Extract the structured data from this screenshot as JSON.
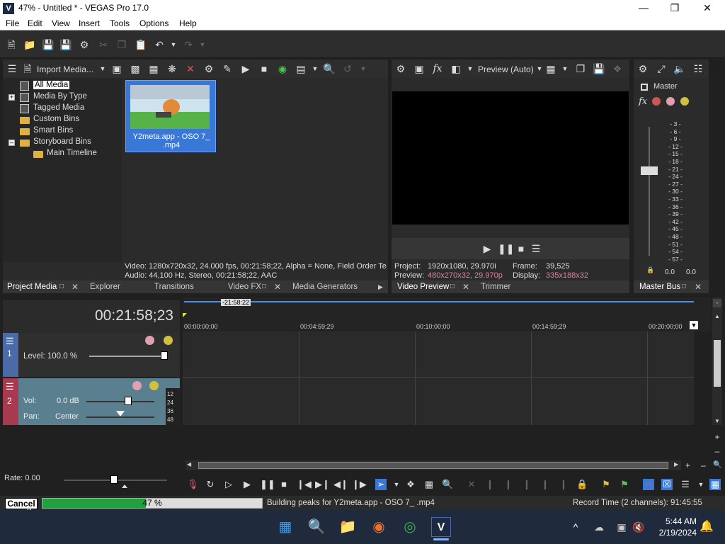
{
  "window": {
    "title": "47% - Untitled * - VEGAS Pro 17.0",
    "logo": "V"
  },
  "menu": [
    "File",
    "Edit",
    "View",
    "Insert",
    "Tools",
    "Options",
    "Help"
  ],
  "project_media": {
    "import_label": "Import Media...",
    "tree": [
      "All Media",
      "Media By Type",
      "Tagged Media",
      "Custom Bins",
      "Smart Bins",
      "Storyboard Bins",
      "Main Timeline"
    ],
    "clip_name": "Y2meta.app - OSO 7_ .mp4",
    "info_video": "Video: 1280x720x32, 24.000 fps, 00:21:58;22, Alpha = None, Field Order Te",
    "info_audio": "Audio: 44,100 Hz, Stereo, 00:21:58;22, AAC"
  },
  "tabs_left": [
    "Project Media",
    "Explorer",
    "Transitions",
    "Video FX",
    "Media Generators"
  ],
  "preview": {
    "mode": "Preview (Auto)",
    "project_label": "Project:",
    "project_val": "1920x1080, 29.970i",
    "preview_label": "Preview:",
    "preview_val": "480x270x32, 29.970p",
    "frame_label": "Frame:",
    "frame_val": "39,525",
    "display_label": "Display:",
    "display_val": "335x188x32"
  },
  "tabs_mid": [
    "Video Preview",
    "Trimmer"
  ],
  "master": {
    "label": "Master",
    "tab": "Master Bus",
    "left": "0.0",
    "right": "0.0",
    "scale": [
      "3",
      "6",
      "9",
      "12",
      "15",
      "18",
      "21",
      "24",
      "27",
      "30",
      "33",
      "36",
      "39",
      "42",
      "45",
      "48",
      "51",
      "54",
      "57"
    ]
  },
  "timeline": {
    "timecode": "00:21:58;23",
    "marker": "-21:58:22",
    "ruler": [
      "00:00:00;00",
      "00:04:59;29",
      "00:10:00;00",
      "00:14:59;29",
      "00:20:00;00"
    ],
    "track1": {
      "num": "1",
      "level": "Level: 100.0 %"
    },
    "track2": {
      "num": "2",
      "vol_label": "Vol:",
      "vol": "0.0 dB",
      "pan_label": "Pan:",
      "pan": "Center",
      "meter": [
        "12",
        "24",
        "36",
        "48"
      ]
    },
    "rate": "Rate: 0.00",
    "level_fraction": 0.98
  },
  "status": {
    "cancel": "Cancel",
    "progress_text": "47 %",
    "progress": 0.47,
    "message": "Building peaks for Y2meta.app - OSO 7_ .mp4",
    "record": "Record Time (2 channels): 91:45:55"
  },
  "taskbar": {
    "time": "5:44 AM",
    "date": "2/19/2024"
  },
  "colors": {
    "accent": "#3a78d8",
    "track1": "#4a6aa8",
    "track2": "#a83a50",
    "progress": "#20a040"
  }
}
